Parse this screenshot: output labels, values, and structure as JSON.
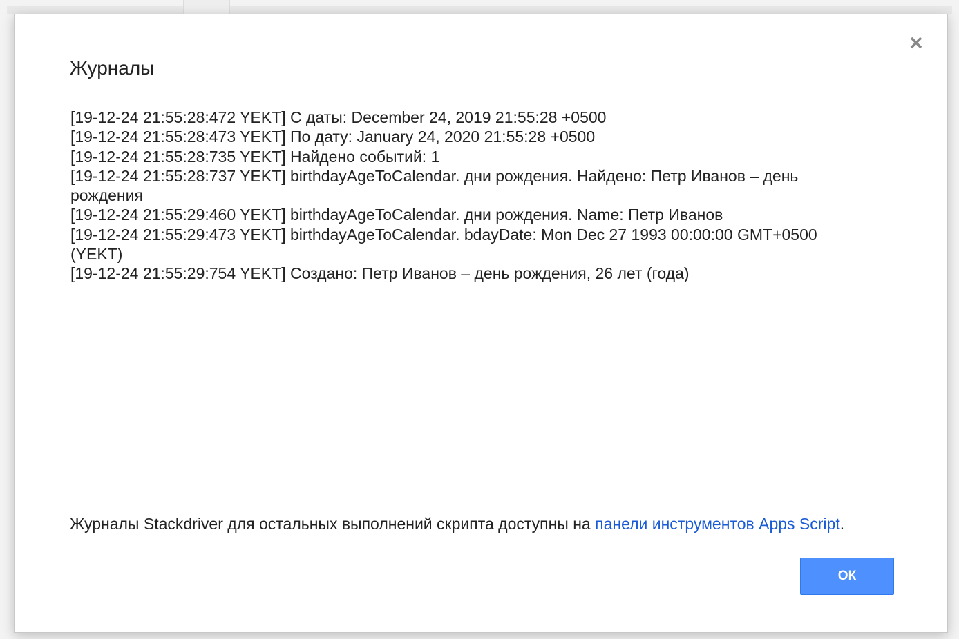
{
  "dialog": {
    "title": "Журналы",
    "close_symbol": "close-icon",
    "log_lines": [
      "[19-12-24 21:55:28:472 YEKT] С даты: December 24, 2019 21:55:28 +0500",
      "[19-12-24 21:55:28:473 YEKT] По дату: January 24, 2020 21:55:28 +0500",
      "[19-12-24 21:55:28:735 YEKT] Найдено событий: 1",
      "[19-12-24 21:55:28:737 YEKT] birthdayAgeToCalendar. дни рождения. Найдено: Петр Иванов – день рождения",
      "[19-12-24 21:55:29:460 YEKT] birthdayAgeToCalendar. дни рождения. Name: Петр Иванов",
      "[19-12-24 21:55:29:473 YEKT] birthdayAgeToCalendar. bdayDate: Mon Dec 27 1993 00:00:00 GMT+0500 (YEKT)",
      "[19-12-24 21:55:29:754 YEKT] Создано: Петр Иванов – день рождения, 26 лет (года)"
    ],
    "footer_prefix": "Журналы Stackdriver для остальных выполнений скрипта доступны на ",
    "footer_link": "панели инструментов Apps Script",
    "footer_suffix": ".",
    "ok_label": "ОК"
  },
  "colors": {
    "link": "#1a5bd6",
    "button": "#4d90fe"
  }
}
